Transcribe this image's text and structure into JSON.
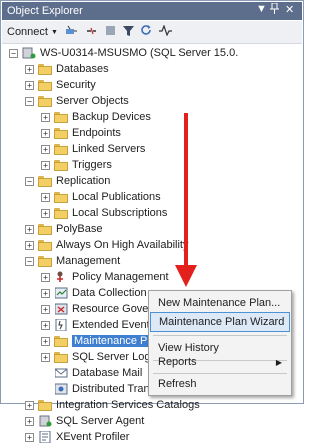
{
  "window": {
    "title": "Object Explorer",
    "controls": [
      "▼",
      "ⅹ",
      "✕"
    ]
  },
  "toolbar": {
    "connect_label": "Connect",
    "icons": [
      "connect-dropdown-icon",
      "connect-icon",
      "disconnect-icon",
      "stop-icon",
      "filter-icon",
      "refresh-icon",
      "activity-monitor-icon"
    ]
  },
  "tree": {
    "server": "WS-U0314-MSUSMO (SQL Server 15.0.",
    "items": [
      {
        "label": "Databases"
      },
      {
        "label": "Security"
      },
      {
        "label": "Server Objects"
      },
      {
        "label": "Backup Devices"
      },
      {
        "label": "Endpoints"
      },
      {
        "label": "Linked Servers"
      },
      {
        "label": "Triggers"
      },
      {
        "label": "Replication"
      },
      {
        "label": "Local Publications"
      },
      {
        "label": "Local Subscriptions"
      },
      {
        "label": "PolyBase"
      },
      {
        "label": "Always On High Availability"
      },
      {
        "label": "Management"
      },
      {
        "label": "Policy Management"
      },
      {
        "label": "Data Collection"
      },
      {
        "label": "Resource Governor"
      },
      {
        "label": "Extended Events"
      },
      {
        "label": "Maintenance Plans"
      },
      {
        "label": "SQL Server Logs"
      },
      {
        "label": "Database Mail"
      },
      {
        "label": "Distributed Transaction Coordinator"
      },
      {
        "label": "Integration Services Catalogs"
      },
      {
        "label": "SQL Server Agent"
      },
      {
        "label": "XEvent Profiler"
      }
    ]
  },
  "context_menu": {
    "items": [
      {
        "label": "New Maintenance Plan..."
      },
      {
        "label": "Maintenance Plan Wizard"
      },
      {
        "label": "View History"
      },
      {
        "label": "Reports"
      },
      {
        "label": "Refresh"
      }
    ],
    "highlighted": "Maintenance Plan Wizard"
  },
  "colors": {
    "titlebar": "#5d6d8c",
    "selection": "#3f7fcf",
    "annotation_arrow": "#e3201b",
    "menu_highlight": "#dde9f7"
  }
}
